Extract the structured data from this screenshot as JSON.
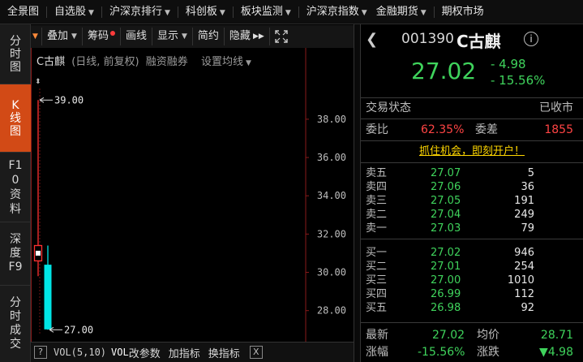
{
  "topnav": {
    "items": [
      {
        "label": "全景图",
        "caret": false
      },
      {
        "label": "自选股",
        "caret": true
      },
      {
        "label": "沪深京排行",
        "caret": true
      },
      {
        "label": "科创板",
        "caret": true
      },
      {
        "label": "板块监测",
        "caret": true
      },
      {
        "label": "沪深京指数",
        "caret": true
      },
      {
        "label": "金融期货",
        "caret": true
      },
      {
        "label": "期权市场",
        "caret": false
      }
    ]
  },
  "sidetabs": [
    {
      "label": "分时图",
      "active": false
    },
    {
      "label": "K线图",
      "active": true
    },
    {
      "label": "F10资料",
      "active": false
    },
    {
      "label": "深度F9",
      "active": false
    },
    {
      "label": "分时成交",
      "active": false
    }
  ],
  "toolbar": {
    "overlay": "叠加",
    "chips": "筹码",
    "draw": "画线",
    "display": "显示",
    "simple": "简约",
    "hide": "隐藏",
    "hide_icon": "double-chevron-right-icon",
    "fullscreen_icon": "fullscreen-icon"
  },
  "chart_header": {
    "stock": "C古麒",
    "mode": "(日线, 前复权)",
    "margin": "融资融券",
    "set_ma": "设置均线"
  },
  "chart_data": {
    "type": "candlestick",
    "ylim": [
      26.8,
      40.2
    ],
    "yticks": [
      "38.00",
      "36.00",
      "34.00",
      "32.00",
      "30.00",
      "28.00"
    ],
    "ytick_values": [
      38,
      36,
      34,
      32,
      30,
      28
    ],
    "candles": [
      {
        "open": 30.6,
        "close": 31.4,
        "high": 39.0,
        "low": 29.8,
        "direction": "up"
      },
      {
        "open": 30.4,
        "close": 27.02,
        "high": 31.4,
        "low": 27.0,
        "direction": "down"
      }
    ],
    "max_label": "39.00",
    "min_label": "27.00",
    "colors": {
      "up": "#ff3030",
      "down": "#00e5e5",
      "axis": "#8a1a1a",
      "grid": "#6b1515"
    }
  },
  "indbar": {
    "help": "?",
    "vol_text": "VOL(5,10)",
    "vol_active": "VOL",
    "change_params": "改参数",
    "add_indicator": "加指标",
    "switch_indicator": "换指标",
    "close": "X"
  },
  "quote": {
    "back_icon": "back-arrow-icon",
    "code": "001390",
    "name": "C古麒",
    "info": "i",
    "price": "27.02",
    "change": "- 4.98",
    "change_pct": "- 15.56%",
    "status_label": "交易状态",
    "status_value": "已收市",
    "wb_label": "委比",
    "wb_value": "62.35%",
    "wc_label": "委差",
    "wc_value": "1855",
    "promo": "抓住机会，即刻开户！",
    "asks": [
      {
        "label": "卖五",
        "price": "27.07",
        "vol": "5"
      },
      {
        "label": "卖四",
        "price": "27.06",
        "vol": "36"
      },
      {
        "label": "卖三",
        "price": "27.05",
        "vol": "191"
      },
      {
        "label": "卖二",
        "price": "27.04",
        "vol": "249"
      },
      {
        "label": "卖一",
        "price": "27.03",
        "vol": "79"
      }
    ],
    "bids": [
      {
        "label": "买一",
        "price": "27.02",
        "vol": "946"
      },
      {
        "label": "买二",
        "price": "27.01",
        "vol": "254"
      },
      {
        "label": "买三",
        "price": "27.00",
        "vol": "1010"
      },
      {
        "label": "买四",
        "price": "26.99",
        "vol": "112"
      },
      {
        "label": "买五",
        "price": "26.98",
        "vol": "92"
      }
    ],
    "last_label": "最新",
    "last_value": "27.02",
    "avg_label": "均价",
    "avg_value": "28.71",
    "pct_label": "涨幅",
    "pct_value": "-15.56%",
    "chg_label": "涨跌",
    "chg_value": "▼4.98"
  }
}
